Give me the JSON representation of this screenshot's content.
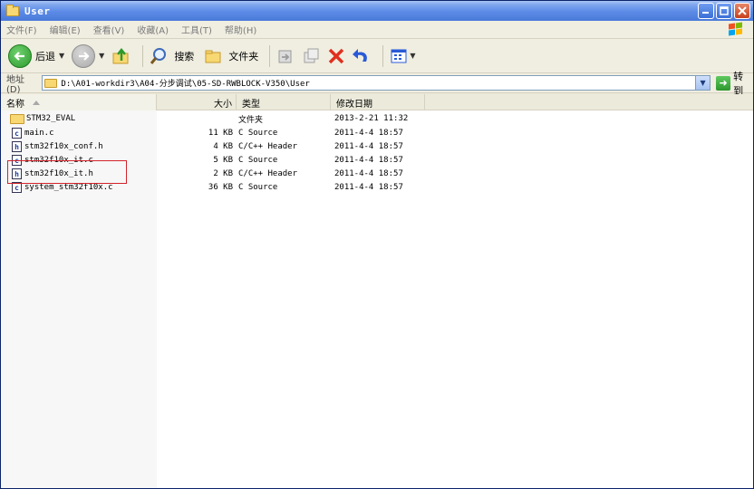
{
  "window": {
    "title": "User"
  },
  "menu": [
    "文件(F)",
    "编辑(E)",
    "查看(V)",
    "收藏(A)",
    "工具(T)",
    "帮助(H)"
  ],
  "toolbar": {
    "back_label": "后退",
    "search_label": "搜索",
    "folders_label": "文件夹"
  },
  "address": {
    "label": "地址(D)",
    "path": "D:\\A01-workdir3\\A04-分步调试\\05-SD-RWBLOCK-V350\\User",
    "go_label": "转到"
  },
  "columns": {
    "name": "名称",
    "size": "大小",
    "type": "类型",
    "modified": "修改日期"
  },
  "files": [
    {
      "name": "STM32_EVAL",
      "size": "",
      "type": "文件夹",
      "modified": "2013-2-21 11:32",
      "icon": "folder"
    },
    {
      "name": "main.c",
      "size": "11 KB",
      "type": "C Source",
      "modified": "2011-4-4 18:57",
      "icon": "c"
    },
    {
      "name": "stm32f10x_conf.h",
      "size": "4 KB",
      "type": "C/C++ Header",
      "modified": "2011-4-4 18:57",
      "icon": "h"
    },
    {
      "name": "stm32f10x_it.c",
      "size": "5 KB",
      "type": "C Source",
      "modified": "2011-4-4 18:57",
      "icon": "c"
    },
    {
      "name": "stm32f10x_it.h",
      "size": "2 KB",
      "type": "C/C++ Header",
      "modified": "2011-4-4 18:57",
      "icon": "h"
    },
    {
      "name": "system_stm32f10x.c",
      "size": "36 KB",
      "type": "C Source",
      "modified": "2011-4-4 18:57",
      "icon": "c"
    }
  ],
  "icon_letters": {
    "c": "c",
    "h": "h"
  },
  "colors": {
    "titlebar": "#4a7ad9",
    "highlight": "#d2232a"
  }
}
